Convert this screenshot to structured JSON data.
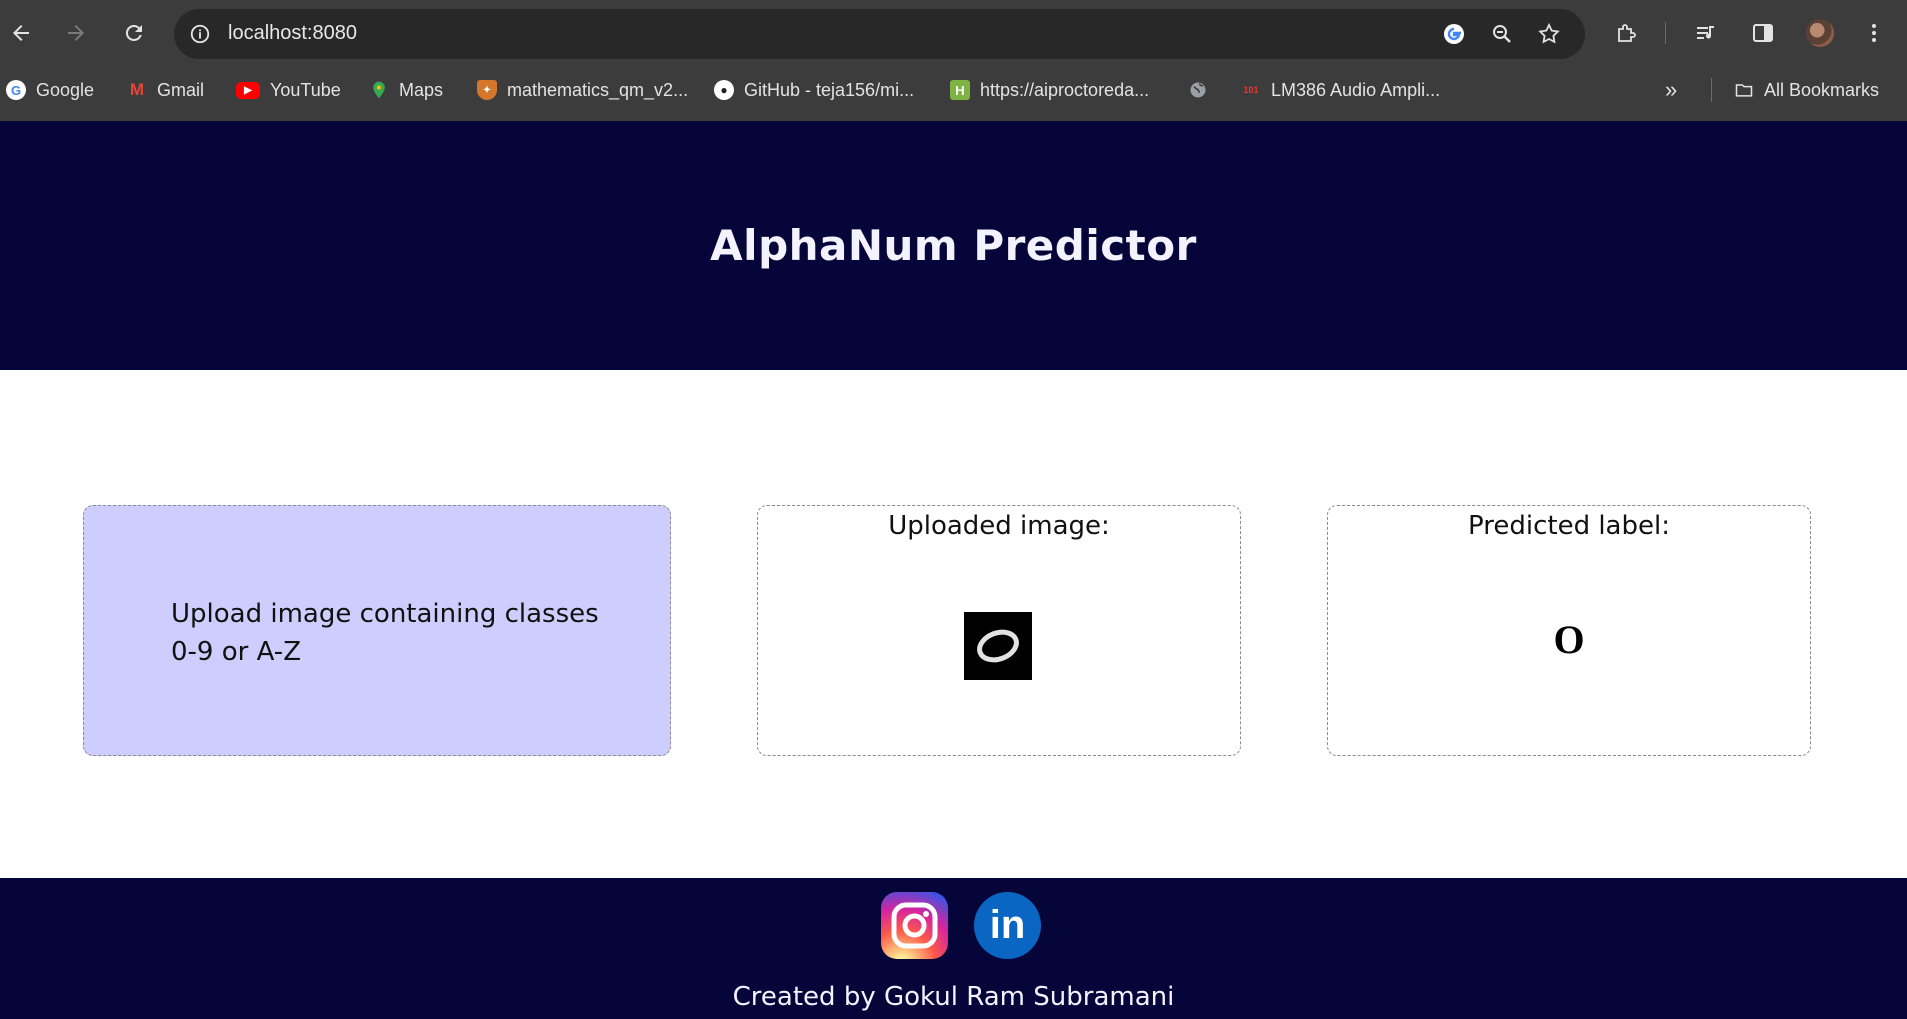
{
  "browser": {
    "url": "localhost:8080",
    "bookmarks": [
      {
        "label": "Google",
        "icon": "google-favicon"
      },
      {
        "label": "Gmail",
        "icon": "gmail-favicon"
      },
      {
        "label": "YouTube",
        "icon": "youtube-favicon"
      },
      {
        "label": "Maps",
        "icon": "maps-favicon"
      },
      {
        "label": "mathematics_qm_v2...",
        "icon": "shield-favicon"
      },
      {
        "label": "GitHub - teja156/mi...",
        "icon": "github-favicon"
      },
      {
        "label": "https://aiproctoreda...",
        "icon": "h-favicon"
      },
      {
        "label": "",
        "icon": "globe-favicon"
      },
      {
        "label": "LM386 Audio Ampli...",
        "icon": "101-favicon"
      }
    ],
    "all_bookmarks_label": "All Bookmarks",
    "overflow_label": "»"
  },
  "page": {
    "title": "AlphaNum Predictor",
    "upload": {
      "text": "Upload image containing classes 0-9 or A-Z"
    },
    "uploaded": {
      "label": "Uploaded image:"
    },
    "prediction": {
      "label": "Predicted label:",
      "value": "O"
    },
    "footer": {
      "credit": "Created by Gokul Ram Subramani",
      "social": [
        "instagram-icon",
        "linkedin-icon"
      ],
      "linkedin_glyph": "in"
    }
  },
  "colors": {
    "header_bg": "#05053a",
    "upload_bg": "#cdcdfe",
    "chrome_bg": "#3c3c3c"
  }
}
